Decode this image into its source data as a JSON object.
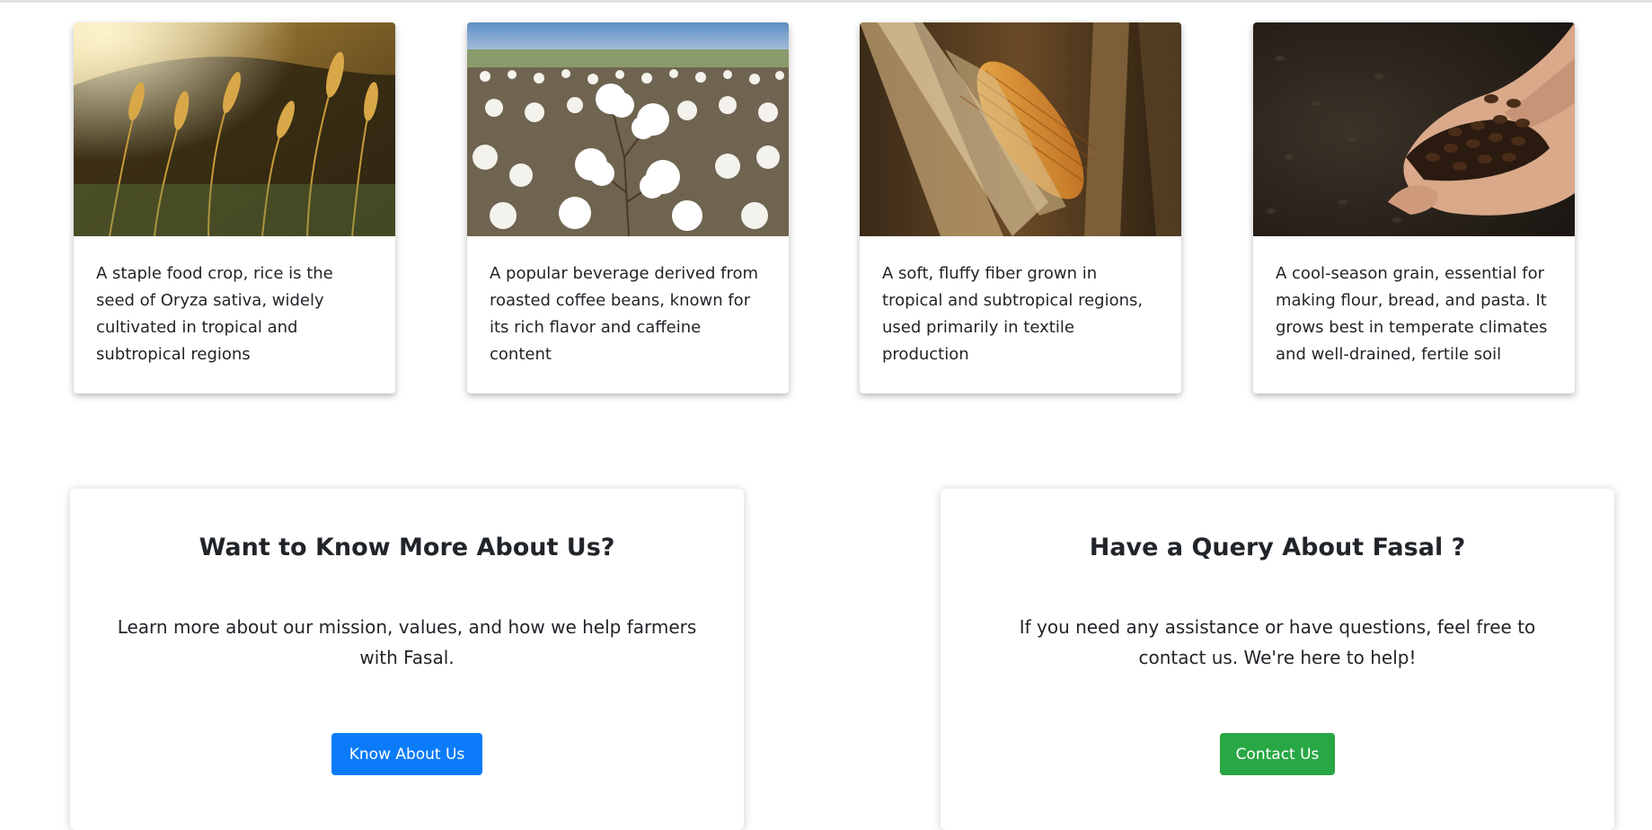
{
  "crops": [
    {
      "icon": "wheat-field-photo",
      "description": "A staple food crop, rice is the seed of Oryza sativa, widely cultivated in tropical and subtropical regions"
    },
    {
      "icon": "cotton-field-photo",
      "description": "A popular beverage derived from roasted coffee beans, known for its rich flavor and caffeine content"
    },
    {
      "icon": "corn-cob-photo",
      "description": "A soft, fluffy fiber grown in tropical and subtropical regions, used primarily in textile production"
    },
    {
      "icon": "coffee-beans-in-hands-photo",
      "description": "A cool-season grain, essential for making flour, bread, and pasta. It grows best in temperate climates and well-drained, fertile soil"
    }
  ],
  "about": {
    "title": "Want to Know More About Us?",
    "text": "Learn more about our mission, values, and how we help farmers with Fasal.",
    "button": "Know About Us"
  },
  "contact": {
    "title": "Have a Query About Fasal ?",
    "text": "If you need any assistance or have questions, feel free to contact us. We're here to help!",
    "button": "Contact Us"
  },
  "colors": {
    "primary_button": "#0b7bf9",
    "success_button": "#28a745",
    "text": "#212529"
  }
}
